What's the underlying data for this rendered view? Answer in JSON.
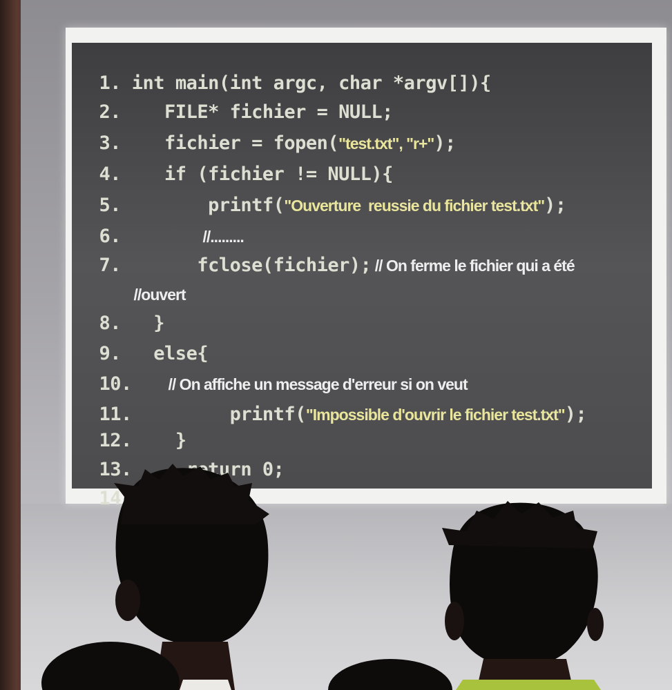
{
  "code_lines": [
    {
      "n": "1.",
      "code": "int main(int argc, char *argv[]){"
    },
    {
      "n": "2.",
      "code": "    FILE* fichier = NULL;"
    },
    {
      "n": "3.",
      "code": "    fichier = fopen(",
      "str": "\"test.txt\", \"r+\"",
      "tail": ");"
    },
    {
      "n": "4.",
      "code": "    if (fichier != NULL){"
    },
    {
      "n": "5.",
      "code": "        printf(",
      "str": "\"Ouverture  reussie du fichier test.txt\"",
      "tail": ");"
    },
    {
      "n": "6.",
      "comment": "//........."
    },
    {
      "n": "7.",
      "code": "       fclose(fichier);",
      "comment": " // On ferme le fichier qui a été"
    },
    {
      "n": "",
      "comment": "//ouvert"
    },
    {
      "n": "8.",
      "code": "   }"
    },
    {
      "n": "9.",
      "code": "   else{"
    },
    {
      "n": "10.",
      "comment": "// On affiche un message d'erreur si on veut"
    },
    {
      "n": "11.",
      "code": "         printf(",
      "str": "\"Impossible d'ouvrir le fichier test.txt\"",
      "tail": ");"
    },
    {
      "n": "12.",
      "code": "    }"
    },
    {
      "n": "13.",
      "code": "     return 0;"
    },
    {
      "n": "14.",
      "code": "}"
    }
  ],
  "colors": {
    "code_text": "#dcdfd2",
    "string_text": "#e9e59c",
    "panel_bg": "#4c4c4e",
    "frame": "#f2f2f0"
  }
}
